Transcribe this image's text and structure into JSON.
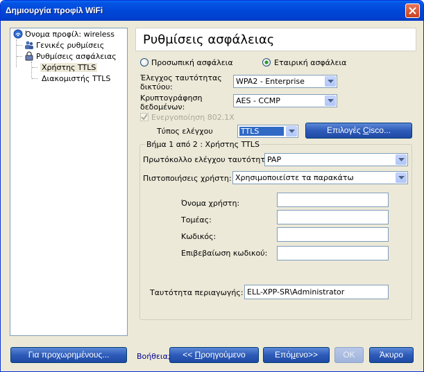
{
  "window": {
    "title": "Δημιουργία προφίλ WiFi"
  },
  "tree": {
    "root": "Όνομα προφίλ: wireless",
    "items": [
      "Γενικές ρυθμίσεις",
      "Ρυθμίσεις ασφάλειας"
    ],
    "subitems": [
      "Χρήστης TTLS",
      "Διακομιστής TTLS"
    ],
    "selected": "Χρήστης TTLS"
  },
  "panel": {
    "title": "Ρυθμίσεις ασφάλειας",
    "radio_personal": "Προσωπική ασφάλεια",
    "radio_enterprise": "Εταιρική ασφάλεια",
    "selected_mode": "enterprise",
    "auth_label_1": "Έλεγχος ταυτότητας",
    "auth_label_2": "δικτύου:",
    "auth_value": "WPA2 - Enterprise",
    "enc_label_1": "Κρυπτογράφηση",
    "enc_label_2": "δεδομένων:",
    "enc_value": "AES - CCMP",
    "enable_8021x": "Ενεργοποίηση 802.1X",
    "auth_type_label": "Τύπος ελέγχου",
    "auth_type_value": "TTLS",
    "cisco_button": "Επιλογές Cisco...",
    "cisco_button_pre": "Επιλογές ",
    "cisco_button_u": "C",
    "cisco_button_post": "isco..."
  },
  "group": {
    "title": "Βήμα 1 από 2 : Χρήστης TTLS",
    "protocol_label": "Πρωτόκολλο ελέγχου ταυτότητας:",
    "protocol_value": "PAP",
    "creds_label": "Πιστοποιήσεις χρήστη:",
    "creds_value": "Χρησιμοποιείστε τα παρακάτω",
    "username_label": "Όνομα χρήστη:",
    "domain_label": "Τομέας:",
    "password_label": "Κωδικός:",
    "confirm_label": "Επιβεβαίωση κωδικού:",
    "roaming_label": "Ταυτότητα περιαγωγής:",
    "roaming_value": "ELL-XPP-SR\\Administrator"
  },
  "footer": {
    "advanced": "Για προχωρημένους...",
    "help": "Βοήθεια;",
    "previous_pre": "<< ",
    "previous_u": "Π",
    "previous_post": "ροηγούμενο",
    "next_pre": "Επό",
    "next_u": "μ",
    "next_post": "ενο>>",
    "ok": "OK",
    "cancel": "Άκυρο"
  },
  "colors": {
    "titlebar": "#0047d8",
    "button": "#2d5bb8",
    "dialog_bg": "#ece9d8",
    "selection": "#316ac5"
  }
}
